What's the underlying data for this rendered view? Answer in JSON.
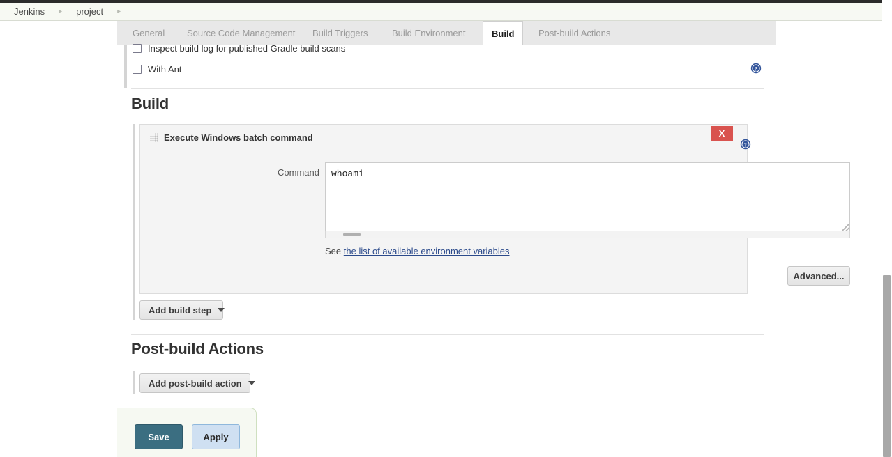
{
  "breadcrumb": {
    "items": [
      {
        "label": "Jenkins"
      },
      {
        "label": "project"
      }
    ],
    "separator": "▸"
  },
  "tabs": [
    {
      "label": "General",
      "active": false
    },
    {
      "label": "Source Code Management",
      "active": false
    },
    {
      "label": "Build Triggers",
      "active": false
    },
    {
      "label": "Build Environment",
      "active": false
    },
    {
      "label": "Build",
      "active": true
    },
    {
      "label": "Post-build Actions",
      "active": false
    }
  ],
  "build_environment": {
    "checkboxes": [
      {
        "label": "Inspect build log for published Gradle build scans",
        "checked": false
      },
      {
        "label": "With Ant",
        "checked": false
      }
    ]
  },
  "build_section": {
    "heading": "Build",
    "step": {
      "title": "Execute Windows batch command",
      "close_label": "X",
      "command_label": "Command",
      "command_value": "whoami",
      "see_prefix": "See",
      "see_link": "the list of available environment variables",
      "advanced_label": "Advanced..."
    },
    "add_build_step_label": "Add build step"
  },
  "postbuild_section": {
    "heading": "Post-build Actions",
    "add_post_build_action_label": "Add post-build action"
  },
  "footer": {
    "save_label": "Save",
    "apply_label": "Apply"
  },
  "icons": {
    "help": "help-icon",
    "drag_grip": "drag-grip-icon",
    "resize_grip": "resize-grip-icon",
    "dropdown_caret": "chevron-down-icon"
  },
  "colors": {
    "close_red": "#d9534f",
    "save_teal": "#3b6e81",
    "apply_blue": "#cfe0f2",
    "link_blue": "#2b4a8b",
    "help_blue": "#33559b"
  }
}
